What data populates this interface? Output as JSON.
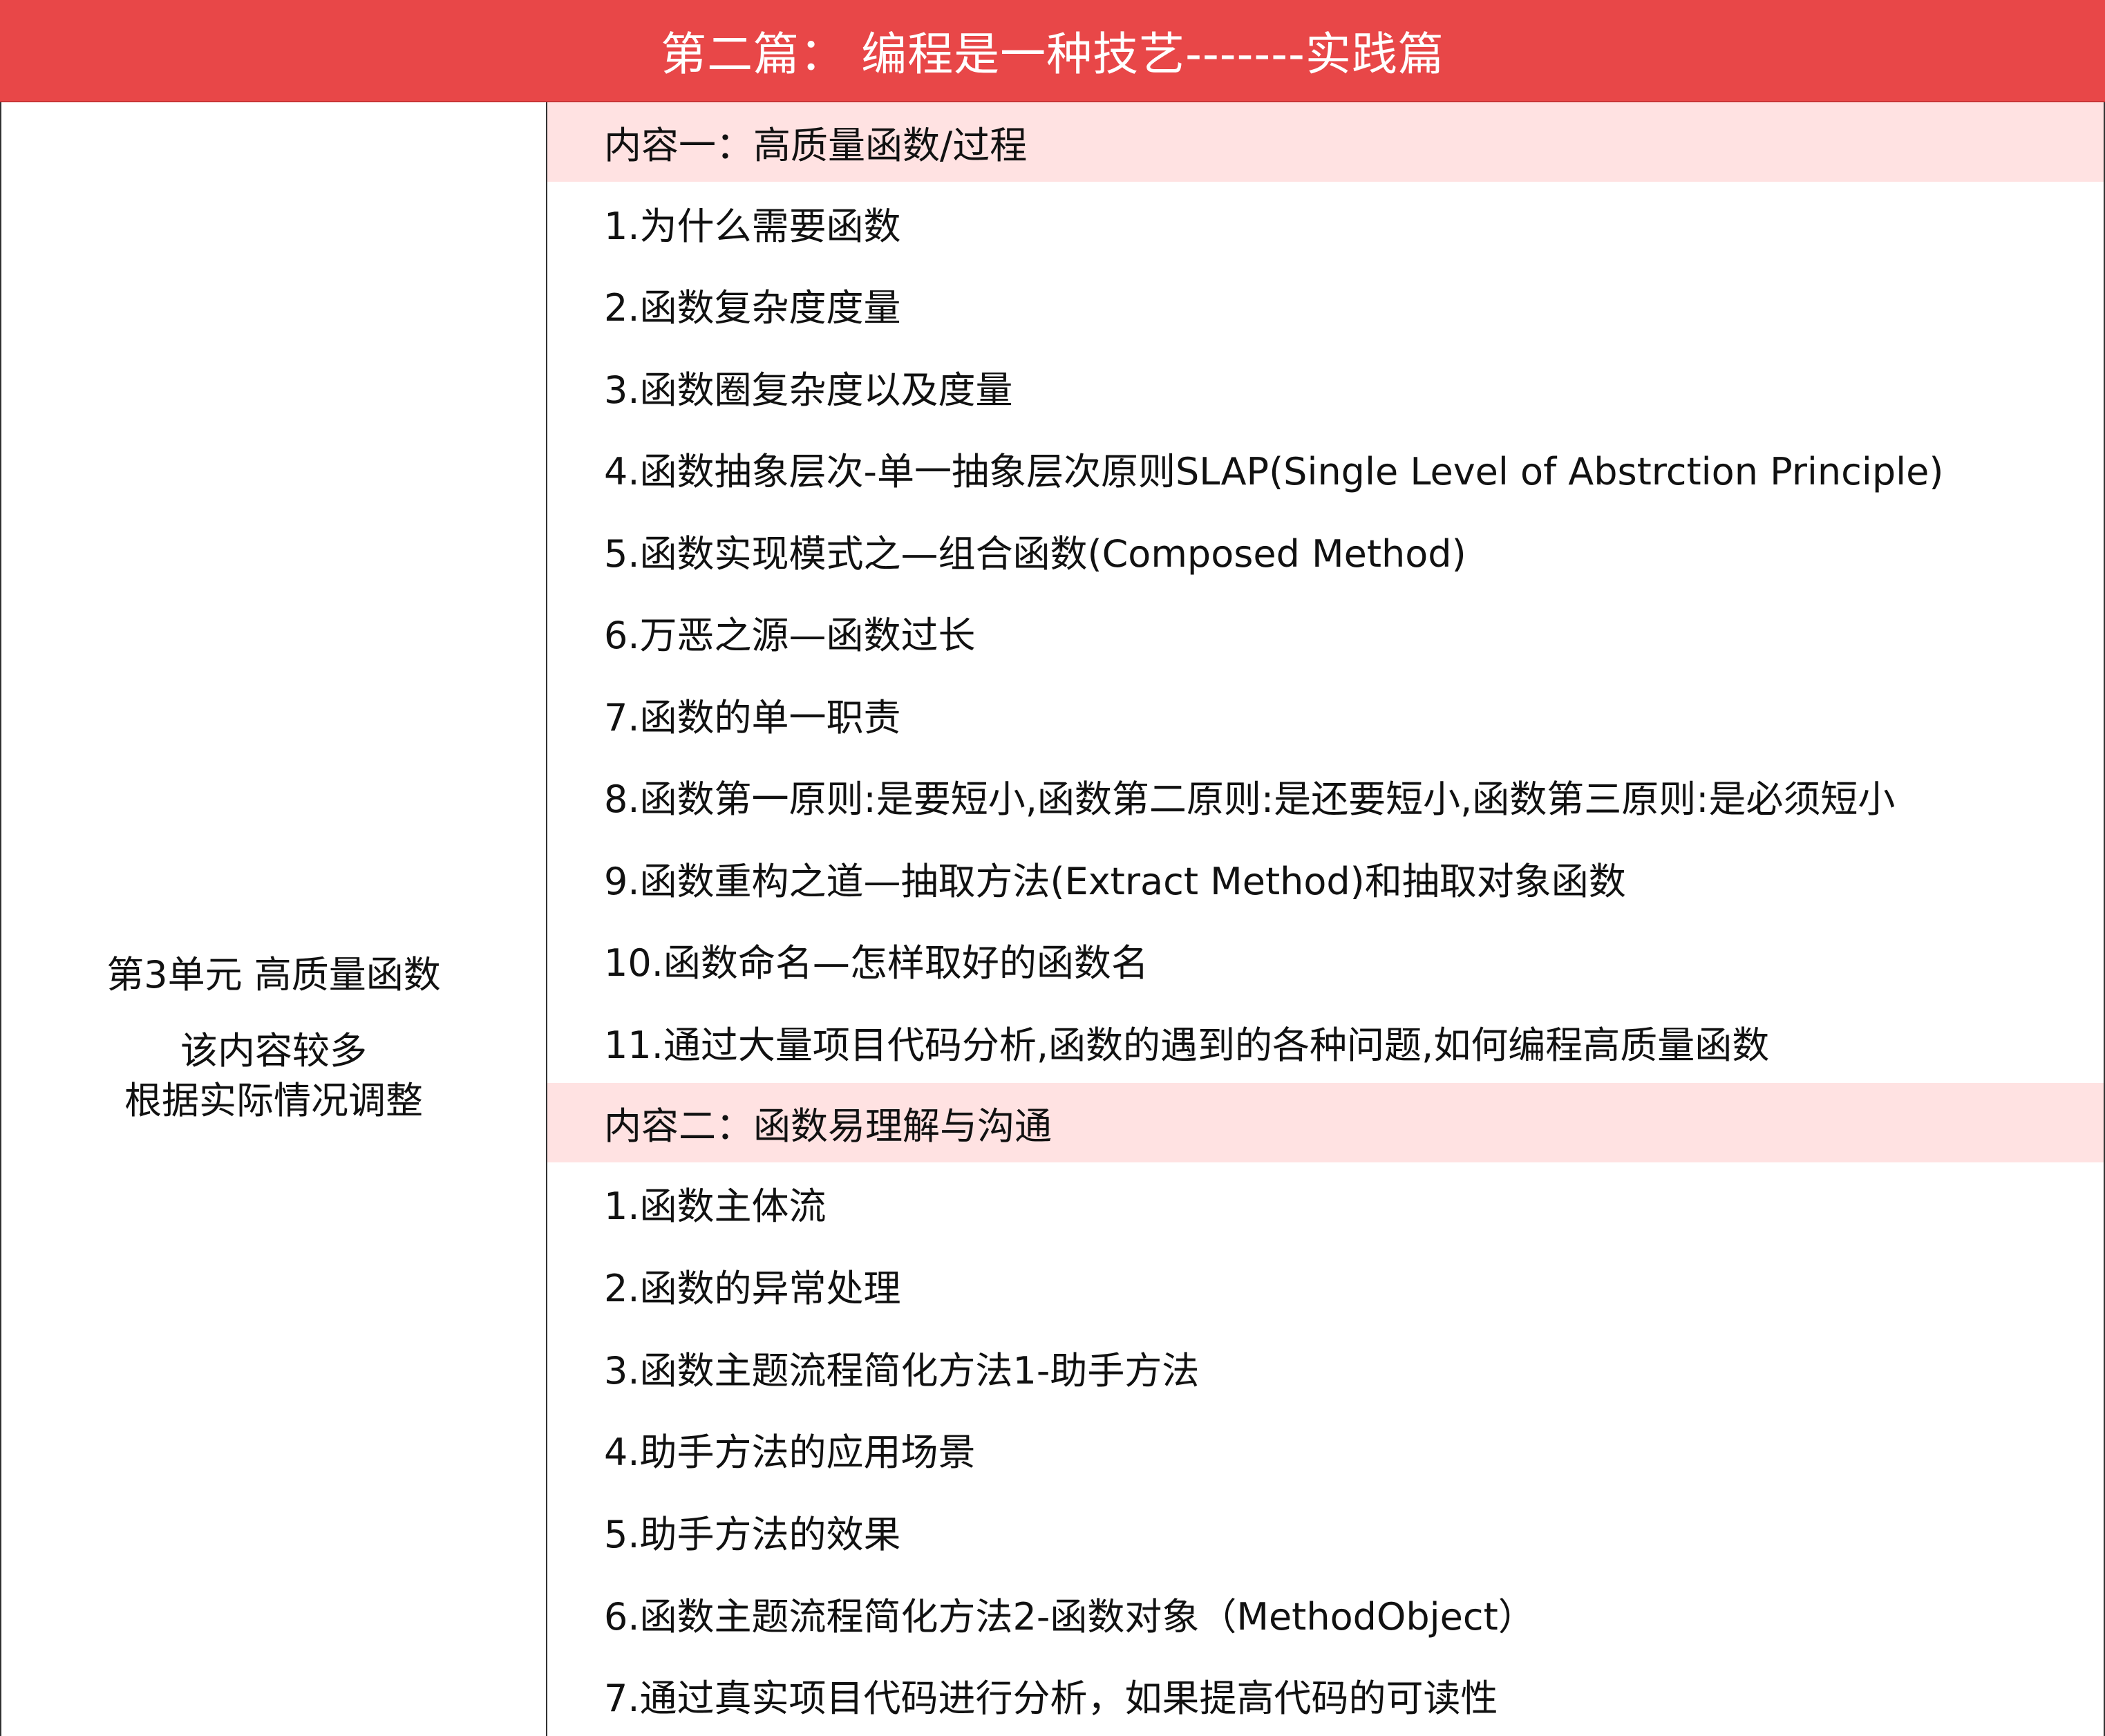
{
  "banner": {
    "title": "第二篇： 编程是一种技艺-------实践篇"
  },
  "unit": {
    "title": "第3单元 高质量函数",
    "note_line1": "该内容较多",
    "note_line2": "根据实际情况调整"
  },
  "sections": [
    {
      "header": "内容一：高质量函数/过程",
      "items": [
        "1.为什么需要函数",
        "2.函数复杂度度量",
        "3.函数圈复杂度以及度量",
        "4.函数抽象层次-单一抽象层次原则SLAP(Single Level of Abstrction Principle)",
        "5.函数实现模式之—组合函数(Composed Method)",
        "6.万恶之源—函数过长",
        "7.函数的单一职责",
        "8.函数第一原则:是要短小,函数第二原则:是还要短小,函数第三原则:是必须短小",
        "9.函数重构之道—抽取方法(Extract Method)和抽取对象函数",
        "10.函数命名—怎样取好的函数名",
        "11.通过大量项目代码分析,函数的遇到的各种问题,如何编程高质量函数"
      ]
    },
    {
      "header": "内容二：函数易理解与沟通",
      "items": [
        "1.函数主体流",
        "2.函数的异常处理",
        "3.函数主题流程简化方法1-助手方法",
        "4.助手方法的应用场景",
        "5.助手方法的效果",
        "6.函数主题流程简化方法2-函数对象（MethodObject）",
        "7.通过真实项目代码进行分析，如果提高代码的可读性"
      ]
    }
  ],
  "colors": {
    "banner_bg": "#e84748",
    "section_header_bg": "#ffe2e2",
    "border": "#333333"
  }
}
